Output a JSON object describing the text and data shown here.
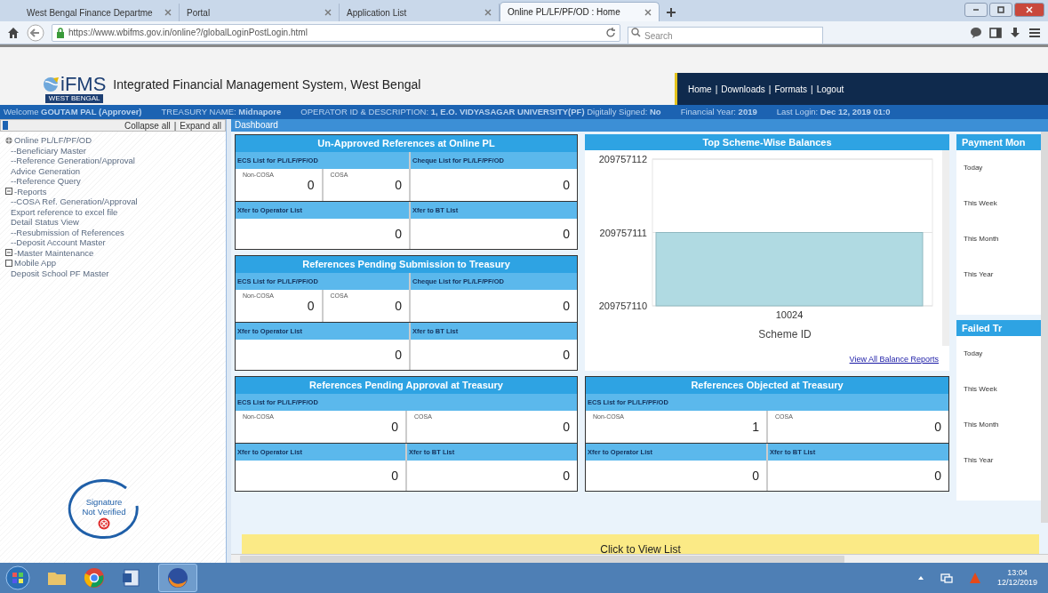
{
  "browser": {
    "tabs": [
      {
        "label": "West Bengal Finance Departme",
        "selected": false
      },
      {
        "label": "Portal",
        "selected": false
      },
      {
        "label": "Application List",
        "selected": false
      },
      {
        "label": "Online PL/LF/PF/OD : Home",
        "selected": true
      }
    ],
    "url": "https://www.wbifms.gov.in/online?/globalLoginPostLogin.html",
    "search": {
      "placeholder": "Search"
    }
  },
  "header": {
    "logo": "iFMS",
    "logo_sub": "WEST BENGAL",
    "title": "Integrated Financial Management System, West Bengal",
    "links": [
      "Home",
      "Downloads",
      "Formats",
      "Logout"
    ],
    "separator": "|"
  },
  "info_bar": [
    "Welcome **GOUTAM PAL (Approver)**",
    "TREASURY NAME: **Midnapore**",
    "OPERATOR ID & DESCRIPTION: **1, E.O. VIDYASAGAR UNIVERSITY(PF)** Digitally Signed: **No**",
    "Financial Year: **2019**",
    "Last Login: **Dec 12, 2019 01:0**"
  ],
  "sidebar": {
    "collapse": "Collapse all",
    "expand": "Expand all",
    "separator": "|",
    "items": [
      {
        "label": "Online PL/LF/PF/OD",
        "kind": "globe",
        "children": [
          {
            "label": "--Beneficiary Master"
          },
          {
            "label": "--Reference Generation/Approval"
          },
          {
            "label": "Advice Generation"
          },
          {
            "label": "--Reference Query"
          }
        ]
      },
      {
        "label": "-Reports",
        "kind": "minus",
        "children": [
          {
            "label": "--COSA Ref. Generation/Approval"
          },
          {
            "label": "Export reference to excel file"
          },
          {
            "label": "Detail Status View"
          },
          {
            "label": "--Resubmission of References"
          },
          {
            "label": "--Deposit Account Master"
          }
        ]
      },
      {
        "label": "-Master Maintenance",
        "kind": "minus"
      },
      {
        "label": "Mobile App",
        "kind": "box",
        "children": [
          {
            "label": "Deposit School PF Master"
          }
        ]
      }
    ],
    "signature": [
      "Signature",
      "Not Verified"
    ]
  },
  "dashboard": {
    "title": "Dashboard",
    "panels": [
      {
        "title": "Un-Approved References at Online PL",
        "kind": "with_cheque",
        "ecs": "ECS List for PL/LF/PF/OD",
        "non_cosa": "Non-COSA",
        "non_cosa_value": "0",
        "cosa": "COSA",
        "cosa_value": "0",
        "cheque": "Cheque List for PL/LF/PF/OD",
        "cheque_value": "0",
        "xfer_operator": "Xfer to Operator List",
        "xfer_operator_value": "0",
        "xfer_bt": "Xfer to BT List",
        "xfer_bt_value": "0"
      },
      {
        "title": "References Pending Submission to Treasury",
        "kind": "with_cheque",
        "ecs": "ECS List for PL/LF/PF/OD",
        "non_cosa": "Non-COSA",
        "non_cosa_value": "0",
        "cosa": "COSA",
        "cosa_value": "0",
        "cheque": "Cheque List for PL/LF/PF/OD",
        "cheque_value": "0",
        "xfer_operator": "Xfer to Operator List",
        "xfer_operator_value": "0",
        "xfer_bt": "Xfer to BT List",
        "xfer_bt_value": "0"
      },
      {
        "title": "References Pending Approval at Treasury",
        "kind": "ecs_only",
        "ecs": "ECS List for PL/LF/PF/OD",
        "non_cosa": "Non-COSA",
        "non_cosa_value": "0",
        "cosa": "COSA",
        "cosa_value": "0",
        "xfer_operator": "Xfer to Operator List",
        "xfer_operator_value": "0",
        "xfer_bt": "Xfer to BT List",
        "xfer_bt_value": "0"
      },
      {
        "title": "References Objected at Treasury",
        "kind": "ecs_only",
        "ecs": "ECS List for PL/LF/PF/OD",
        "non_cosa": "Non-COSA",
        "non_cosa_value": "1",
        "cosa": "COSA",
        "cosa_value": "0",
        "xfer_operator": "Xfer to Operator List",
        "xfer_operator_value": "0",
        "xfer_bt": "Xfer to BT List",
        "xfer_bt_value": "0"
      }
    ],
    "balances": {
      "title": "Top Scheme-Wise Balances",
      "link": "View All Balance Reports",
      "chart_data": {
        "type": "bar",
        "xlabel": "Scheme ID",
        "categories": [
          "10024"
        ],
        "values": [
          209757111
        ],
        "ylim": [
          209757110,
          209757112
        ],
        "yticks": [
          209757110,
          209757111,
          209757112
        ]
      }
    },
    "payment": {
      "title": "Payment Mon",
      "rows": [
        "Today",
        "This Week",
        "This Month",
        "This Year"
      ]
    },
    "failed": {
      "title": "Failed Tr",
      "rows": [
        "Today",
        "This Week",
        "This Month",
        "This Year"
      ]
    },
    "view_list": "Click to View List"
  },
  "taskbar": {
    "time": "13:04",
    "date": "12/12/2019"
  }
}
